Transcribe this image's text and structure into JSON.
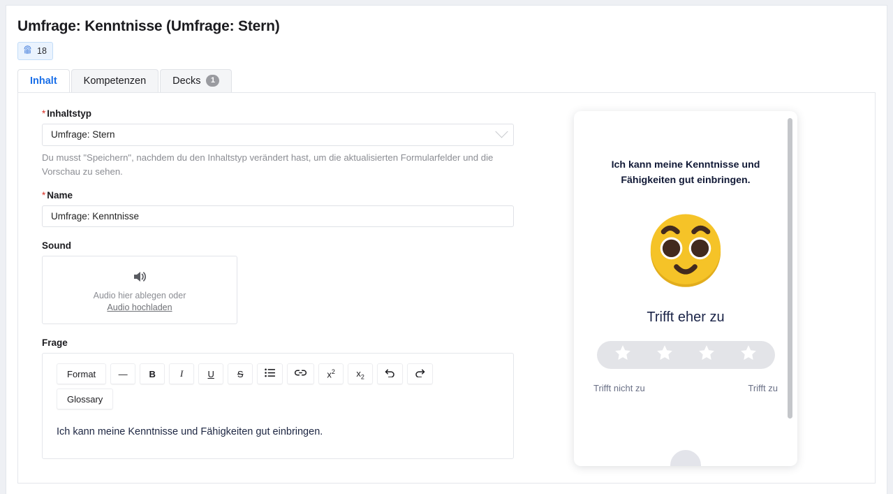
{
  "header": {
    "title": "Umfrage: Kenntnisse (Umfrage: Stern)",
    "badge": {
      "icon": "fingerprint-icon",
      "count": "18"
    }
  },
  "tabs": [
    {
      "label": "Inhalt",
      "active": true,
      "count": null
    },
    {
      "label": "Kompetenzen",
      "active": false,
      "count": null
    },
    {
      "label": "Decks",
      "active": false,
      "count": "1"
    }
  ],
  "form": {
    "content_type": {
      "label": "Inhaltstyp",
      "required_marker": "*",
      "value": "Umfrage: Stern",
      "help": "Du musst \"Speichern\", nachdem du den Inhaltstyp verändert hast, um die aktualisierten Formularfelder und die Vorschau zu sehen."
    },
    "name": {
      "label": "Name",
      "required_marker": "*",
      "value": "Umfrage: Kenntnisse",
      "placeholder": "Name"
    },
    "sound": {
      "label": "Sound",
      "drop_text": "Audio hier ablegen oder",
      "upload_link": "Audio hochladen",
      "icon": "speaker-icon"
    },
    "question": {
      "label": "Frage",
      "toolbar": [
        {
          "label": "Format",
          "name": "format-button"
        },
        {
          "label": "—",
          "name": "horizontal-rule-button"
        },
        {
          "label": "B",
          "name": "bold-button"
        },
        {
          "label": "I",
          "name": "italic-button"
        },
        {
          "label": "U",
          "name": "underline-button"
        },
        {
          "label": "S",
          "name": "strikethrough-button"
        },
        {
          "label": "",
          "name": "bullet-list-button"
        },
        {
          "label": "",
          "name": "link-button"
        },
        {
          "label": "x2",
          "name": "superscript-button"
        },
        {
          "label": "x2",
          "name": "subscript-button"
        },
        {
          "label": "",
          "name": "undo-button"
        },
        {
          "label": "",
          "name": "redo-button"
        }
      ],
      "toolbar_row2": [
        {
          "label": "Glossary",
          "name": "glossary-button"
        }
      ],
      "body": "Ich kann meine Kenntnisse und Fähigkeiten gut einbringen."
    }
  },
  "preview": {
    "question": "Ich kann meine Kenntnisse und Fähigkeiten gut einbringen.",
    "emoji": "smiling-face-icon",
    "rating_label": "Trifft eher zu",
    "stars": 4,
    "low_label": "Trifft nicht zu",
    "high_label": "Trifft zu"
  },
  "colors": {
    "accent": "#1a6fe8",
    "required": "#d93025",
    "emoji_yellow": "#f5c328",
    "emoji_dark": "#422a1e",
    "badge_bg": "#eaf3fe"
  }
}
